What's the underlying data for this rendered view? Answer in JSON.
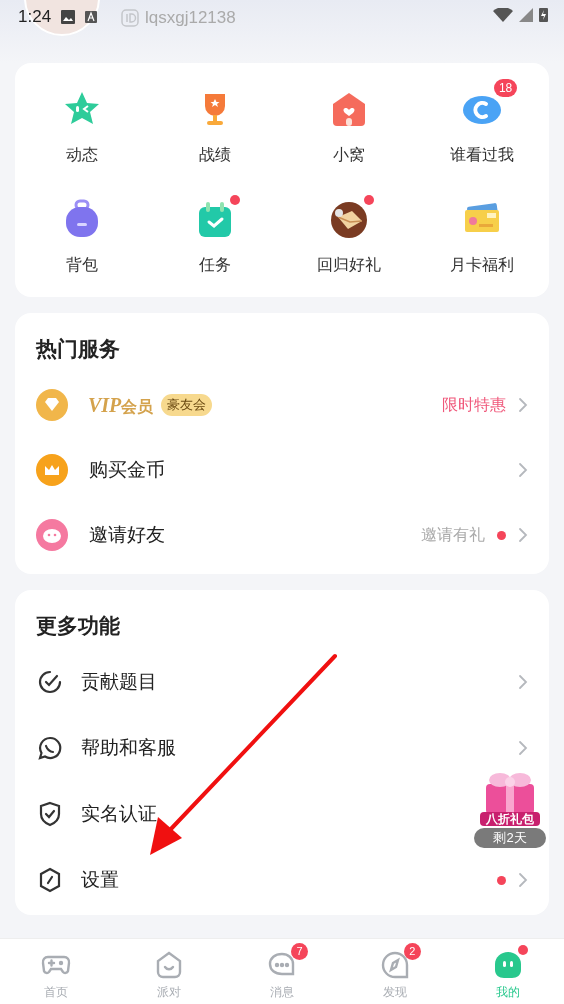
{
  "status_bar": {
    "time": "1:24"
  },
  "profile": {
    "id": "lqsxgj12138"
  },
  "shortcuts": [
    {
      "label": "动态"
    },
    {
      "label": "战绩"
    },
    {
      "label": "小窝"
    },
    {
      "label": "谁看过我",
      "badge": "18"
    },
    {
      "label": "背包"
    },
    {
      "label": "任务",
      "dot": true
    },
    {
      "label": "回归好礼",
      "dot": true
    },
    {
      "label": "月卡福利"
    }
  ],
  "hot_services": {
    "title": "热门服务",
    "items": [
      {
        "kind": "vip",
        "label": "VIP",
        "label_suffix": "会员",
        "tag": "豪友会",
        "note": "限时特惠",
        "highlight": true
      },
      {
        "kind": "plain",
        "label": "购买金币"
      },
      {
        "kind": "plain",
        "label": "邀请好友",
        "note": "邀请有礼",
        "highlight": false,
        "dot": true
      }
    ]
  },
  "more": {
    "title": "更多功能",
    "items": [
      {
        "label": "贡献题目"
      },
      {
        "label": "帮助和客服"
      },
      {
        "label": "实名认证",
        "chevron": false
      },
      {
        "label": "设置",
        "dot": true
      }
    ]
  },
  "promo": {
    "label": "八折礼包",
    "countdown": "剩2天"
  },
  "tabs": [
    {
      "label": "首页",
      "selected": false
    },
    {
      "label": "派对",
      "selected": false
    },
    {
      "label": "消息",
      "selected": false,
      "badge": "7"
    },
    {
      "label": "发现",
      "selected": false,
      "badge": "2"
    },
    {
      "label": "我的",
      "selected": true,
      "dot": true
    }
  ]
}
